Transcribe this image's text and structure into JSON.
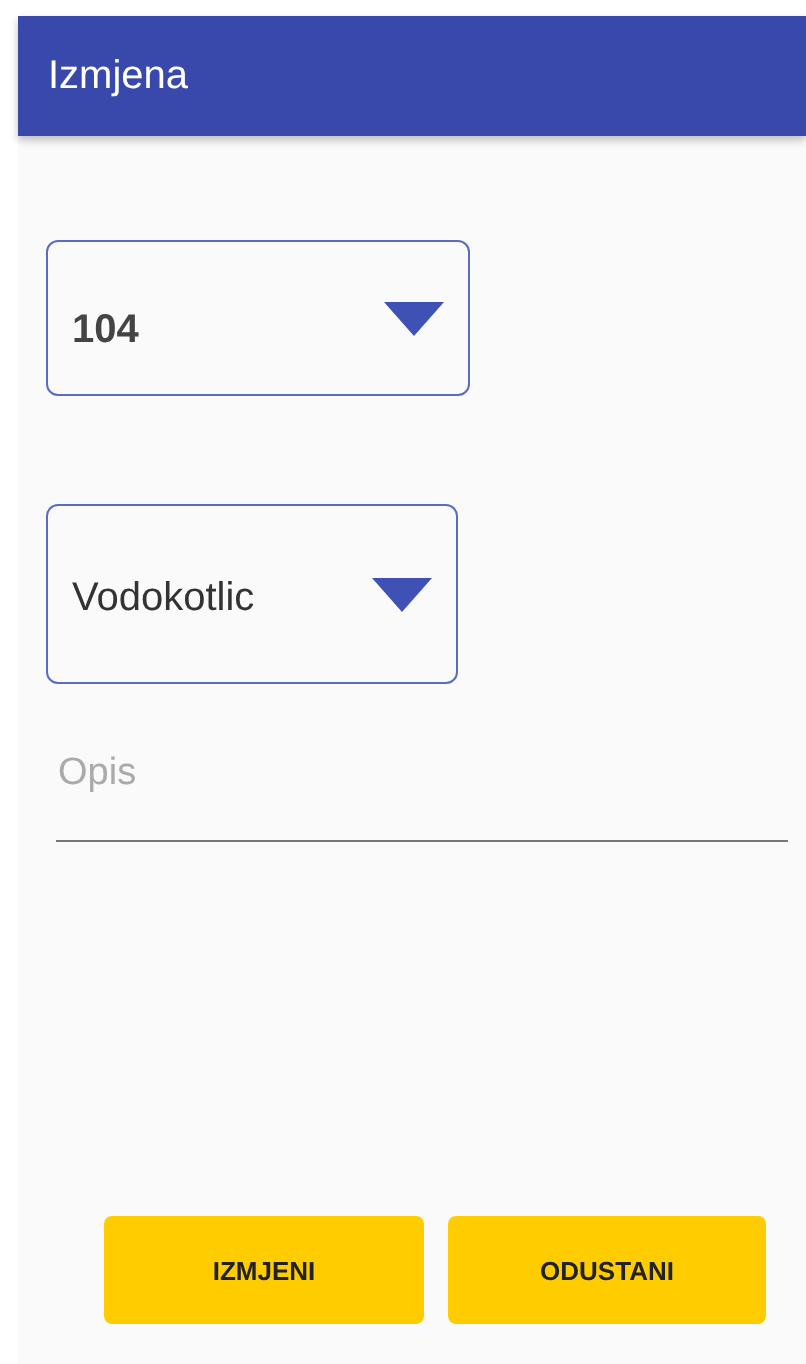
{
  "app_bar": {
    "title": "Izmjena"
  },
  "spinners": [
    {
      "value": "104",
      "bold": true
    },
    {
      "value": "Vodokotlic",
      "bold": false
    }
  ],
  "description_field": {
    "placeholder": "Opis"
  },
  "buttons": [
    "IZMJENI",
    "ODUSTANI"
  ]
}
